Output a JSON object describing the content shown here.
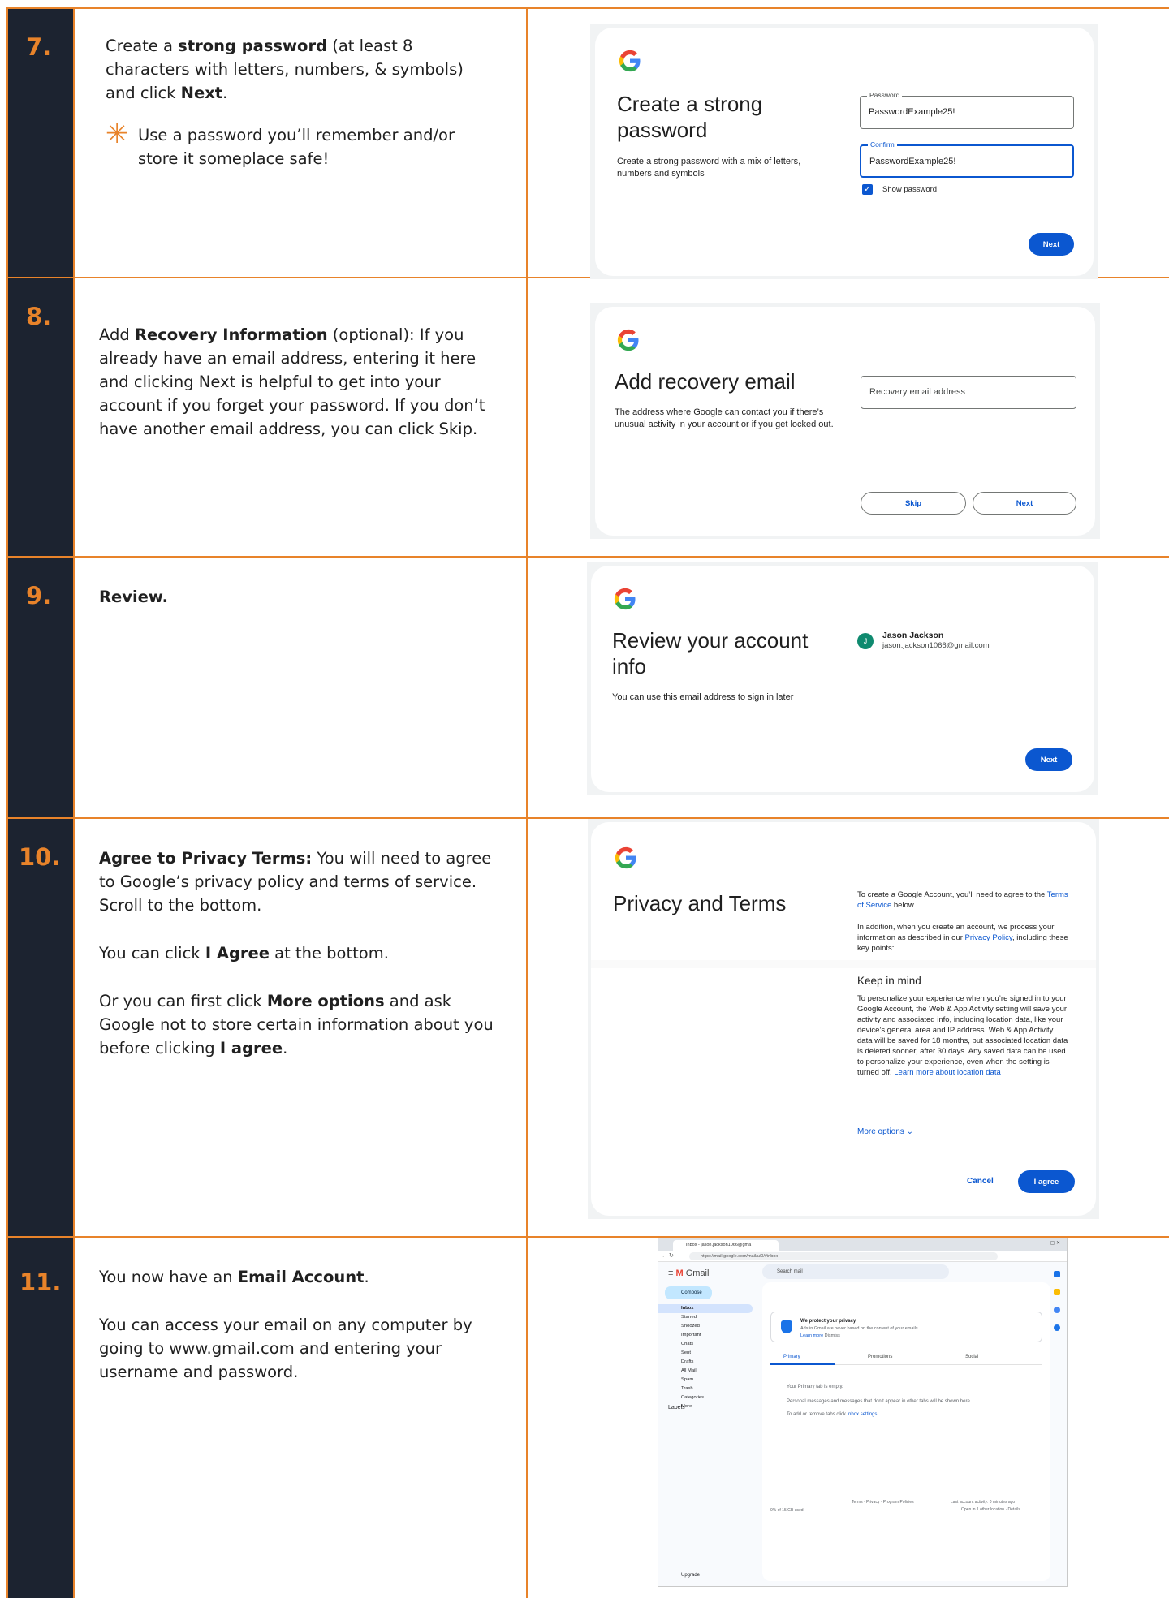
{
  "steps": [
    {
      "number": "7.",
      "text_html_parts": {
        "p1_a": "Create a ",
        "p1_b": "strong password",
        "p1_c": " (at least 8 characters with letters, numbers, & symbols) and click ",
        "p1_d": "Next",
        "p1_e": "."
      },
      "tip": "Use a password you’ll remember and/or store it someplace safe!",
      "card": {
        "title": "Create a strong password",
        "subtitle": "Create a strong password with a mix of letters, numbers and symbols",
        "password_label": "Password",
        "password_value": "PasswordExample25!",
        "confirm_label": "Confirm",
        "confirm_value": "PasswordExample25!",
        "show_password": "Show password",
        "next": "Next"
      }
    },
    {
      "number": "8.",
      "text_parts": {
        "a": "Add ",
        "b": "Recovery Information",
        "c": " (optional): If you already have an email address, entering it here and clicking Next is helpful to get into your account if you forget your password.  If you don’t have another email address, you can click Skip."
      },
      "card": {
        "title": "Add recovery email",
        "subtitle": "The address where Google can contact you if there’s unusual activity in your account or if you get locked out.",
        "placeholder": "Recovery email address",
        "skip": "Skip",
        "next": "Next"
      }
    },
    {
      "number": "9.",
      "text": "Review.",
      "card": {
        "title": "Review your account info",
        "subtitle": "You can use this email address to sign in later",
        "avatar": "J",
        "name": "Jason Jackson",
        "email": "jason.jackson1066@gmail.com",
        "next": "Next"
      }
    },
    {
      "number": "10.",
      "p1_bold": "Agree to Privacy Terms:",
      "p1_rest": " You will need to agree to Google’s privacy policy and terms of service.  Scroll to the bottom.",
      "p2_a": "You can click ",
      "p2_b": "I Agree",
      "p2_c": " at the bottom.",
      "p3_a": "Or you can first click ",
      "p3_b": "More options",
      "p3_c": " and ask Google not to store certain information about you before clicking ",
      "p3_d": "I agree",
      "p3_e": ".",
      "card": {
        "title": "Privacy and Terms",
        "intro_a": "To create a Google Account, you’ll need to agree to the ",
        "intro_link": "Terms of Service",
        "intro_b": " below.",
        "para2_a": "In addition, when you create an account, we process your information as described in our ",
        "para2_link": "Privacy Policy",
        "para2_b": ", including these key points:",
        "keep_heading": "Keep in mind",
        "keep_text": "To personalize your experience when you’re signed in to your Google Account, the Web & App Activity setting will save your activity and associated info, including location data, like your device’s general area and IP address. Web & App Activity data will be saved for 18 months, but associated location data is deleted sooner, after 30 days. Any saved data can be used to personalize your experience, even when the setting is turned off. ",
        "keep_link": "Learn more about location data",
        "more_options": "More options",
        "cancel": "Cancel",
        "agree": "I agree"
      }
    },
    {
      "number": "11.",
      "p1_a": "You now have an ",
      "p1_b": "Email Account",
      "p1_c": ".",
      "p2": "You can access your email on any computer by going to www.gmail.com and entering your username and password.",
      "gmail": {
        "tab_title": "Inbox - jason.jackson1066@gma",
        "url": "https://mail.google.com/mail/u/0/#inbox",
        "app_name": "Gmail",
        "search_placeholder": "Search mail",
        "compose": "Compose",
        "nav": [
          "Inbox",
          "Starred",
          "Snoozed",
          "Important",
          "Chats",
          "Sent",
          "Drafts",
          "All Mail",
          "Spam",
          "Trash",
          "Categories",
          "More"
        ],
        "labels": "Labels",
        "upgrade": "Upgrade",
        "privacy_title": "We protect your privacy",
        "privacy_text": "Ads in Gmail are never based on the content of your emails.",
        "learn_more": "Learn more",
        "dismiss": "Dismiss",
        "tabs": [
          "Primary",
          "Promotions",
          "Social"
        ],
        "empty_title": "Your Primary tab is empty.",
        "empty_text": "Personal messages and messages that don’t appear in other tabs will be shown here.",
        "empty_link_a": "To add or remove tabs click ",
        "empty_link": "inbox settings",
        "storage": "0% of 15 GB used",
        "footer_links": "Terms · Privacy · Program Policies",
        "activity": "Last account activity: 0 minutes ago",
        "activity2": "Open in 1 other location · Details"
      }
    }
  ],
  "colors": {
    "accent": "#e8832a",
    "sidebar": "#1c2330",
    "google_blue": "#0b57d0"
  }
}
